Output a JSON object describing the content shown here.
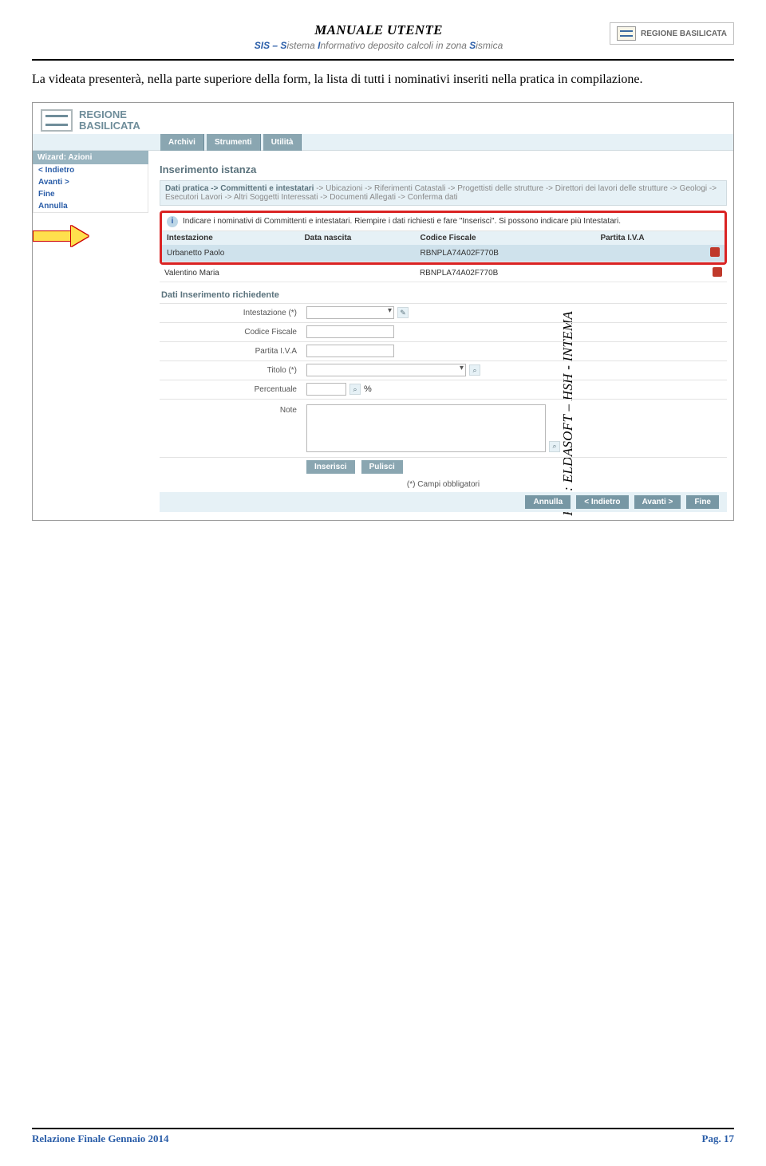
{
  "doc_header": {
    "title": "MANUALE UTENTE",
    "subtitle_prefix": "SIS – ",
    "subtitle_s": "S",
    "subtitle_istema": "istema ",
    "subtitle_i": "I",
    "subtitle_nformativo": "nformativo deposito calcoli in zona ",
    "subtitle_lasts": "S",
    "subtitle_ismica": "ismica",
    "logo_text": "REGIONE BASILICATA"
  },
  "body_paragraph": "La videata presenterà, nella parte superiore della form, la lista di tutti i nominativi inseriti nella pratica in compilazione.",
  "side_text": "RTI : ELDASOFT – HSH - INTEMA",
  "screenshot": {
    "brand_line1": "REGIONE",
    "brand_line2": "BASILICATA",
    "tabs": [
      "Archivi",
      "Strumenti",
      "Utilità"
    ],
    "sidebar": {
      "header": "Wizard: Azioni",
      "items": [
        "< Indietro",
        "Avanti >",
        "Fine",
        "Annulla"
      ]
    },
    "page_title": "Inserimento istanza",
    "breadcrumb_strong": "Dati pratica -> Committenti e intestatari",
    "breadcrumb_rest": " -> Ubicazioni -> Riferimenti Catastali -> Progettisti delle strutture -> Direttori dei lavori delle strutture -> Geologi -> Esecutori Lavori -> Altri Soggetti Interessati -> Documenti Allegati -> Conferma dati",
    "info_text": "Indicare i nominativi di Committenti e intestatari. Riempire i dati richiesti e fare \"Inserisci\". Si possono indicare più Intestatari.",
    "table_headers": [
      "Intestazione",
      "Data nascita",
      "Codice Fiscale",
      "Partita I.V.A"
    ],
    "rows": [
      {
        "name": "Urbanetto Paolo",
        "dob": "",
        "cf": "RBNPLA74A02F770B",
        "piva": ""
      },
      {
        "name": "Valentino Maria",
        "dob": "",
        "cf": "RBNPLA74A02F770B",
        "piva": ""
      }
    ],
    "section_header": "Dati Inserimento richiedente",
    "form_labels": {
      "intestazione": "Intestazione (*)",
      "cf": "Codice Fiscale",
      "piva": "Partita I.V.A",
      "titolo": "Titolo (*)",
      "percentuale": "Percentuale",
      "note": "Note",
      "percent_sign": "%"
    },
    "buttons": {
      "inserisci": "Inserisci",
      "pulisci": "Pulisci"
    },
    "required_hint": "(*) Campi obbligatori",
    "bottom_buttons": [
      "Annulla",
      "< Indietro",
      "Avanti >",
      "Fine"
    ]
  },
  "footer": {
    "left": "Relazione Finale Gennaio 2014",
    "right": "Pag.  17"
  }
}
